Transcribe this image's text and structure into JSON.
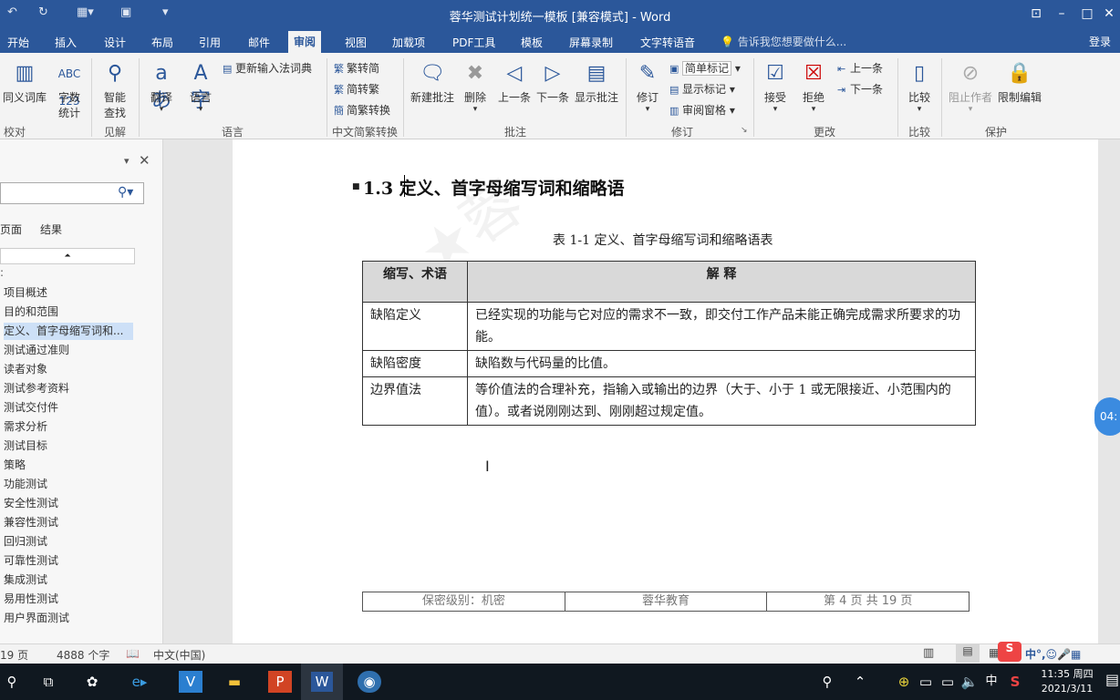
{
  "window": {
    "title": "蓉华测试计划统一模板 [兼容模式] - Word",
    "quick_access": [
      "↶",
      "↻",
      "⊞ ▾",
      "▣",
      "▾"
    ]
  },
  "tabs": [
    "开始",
    "插入",
    "设计",
    "布局",
    "引用",
    "邮件",
    "审阅",
    "视图",
    "加载项",
    "PDF工具",
    "模板",
    "屏幕录制",
    "文字转语音"
  ],
  "active_tab": "审阅",
  "tell_me_placeholder": "告诉我您想要做什么...",
  "sign_in": "登录",
  "ribbon": {
    "proofing": {
      "label": "校对",
      "buttons": [
        "同义词库",
        "字数\n统计"
      ]
    },
    "insights": {
      "label": "见解",
      "buttons": [
        "智能\n查找"
      ]
    },
    "language": {
      "label": "语言",
      "buttons": [
        "翻译",
        "语言"
      ],
      "small": [
        "更新输入法词典"
      ]
    },
    "chinese": {
      "label": "中文简繁转换",
      "small": [
        "繁转简",
        "简转繁",
        "简繁转换"
      ]
    },
    "comments": {
      "label": "批注",
      "buttons": [
        "新建批注",
        "删除",
        "上一条",
        "下一条",
        "显示批注"
      ]
    },
    "tracking": {
      "label": "修订",
      "buttons": [
        "修订"
      ],
      "small": [
        "简单标记",
        "显示标记",
        "审阅窗格"
      ]
    },
    "changes": {
      "label": "更改",
      "buttons": [
        "接受",
        "拒绝"
      ],
      "small": [
        "上一条",
        "下一条"
      ]
    },
    "compare": {
      "label": "比较",
      "buttons": [
        "比较"
      ]
    },
    "protect": {
      "label": "保护",
      "buttons": [
        "阻止作者",
        "限制编辑"
      ]
    }
  },
  "nav": {
    "tabs": [
      "页面",
      "结果"
    ],
    "items": [
      {
        "label": "项目概述",
        "sel": false
      },
      {
        "label": "目的和范围",
        "sel": false
      },
      {
        "label": "定义、首字母缩写词和...",
        "sel": true
      },
      {
        "label": "测试通过准则",
        "sel": false
      },
      {
        "label": "读者对象",
        "sel": false
      },
      {
        "label": "测试参考资料",
        "sel": false
      },
      {
        "label": "测试交付件",
        "sel": false
      },
      {
        "label": "需求分析",
        "sel": false
      },
      {
        "label": "测试目标",
        "sel": false
      },
      {
        "label": "策略",
        "sel": false
      },
      {
        "label": "功能测试",
        "sel": false
      },
      {
        "label": "安全性测试",
        "sel": false
      },
      {
        "label": "兼容性测试",
        "sel": false
      },
      {
        "label": "回归测试",
        "sel": false
      },
      {
        "label": "可靠性测试",
        "sel": false
      },
      {
        "label": "集成测试",
        "sel": false
      },
      {
        "label": "易用性测试",
        "sel": false
      },
      {
        "label": "用户界面测试",
        "sel": false
      }
    ]
  },
  "document": {
    "heading": "1.3  定义、首字母缩写词和缩略语",
    "table_caption": "表 1-1  定义、首字母缩写词和缩略语表",
    "table": {
      "headers": [
        "缩写、术语",
        "解  释"
      ],
      "rows": [
        [
          "缺陷定义",
          "已经实现的功能与它对应的需求不一致，即交付工作产品未能正确完成需求所要求的功能。"
        ],
        [
          "缺陷密度",
          "缺陷数与代码量的比值。"
        ],
        [
          "边界值法",
          "等价值法的合理补充，指输入或输出的边界（大于、小于 1 或无限接近、小范围内的值）。或者说刚刚达到、刚刚超过规定值。"
        ]
      ]
    },
    "footer": [
      "保密级别：机密",
      "蓉华教育",
      "第 4 页 共 19 页"
    ],
    "side_badge": "04:"
  },
  "status": {
    "pages": "19 页",
    "words": "4888 个字",
    "lang": "中文(中国)"
  },
  "taskbar": {
    "time": "11:35 周四",
    "date": "2021/3/11",
    "ime": "中"
  }
}
